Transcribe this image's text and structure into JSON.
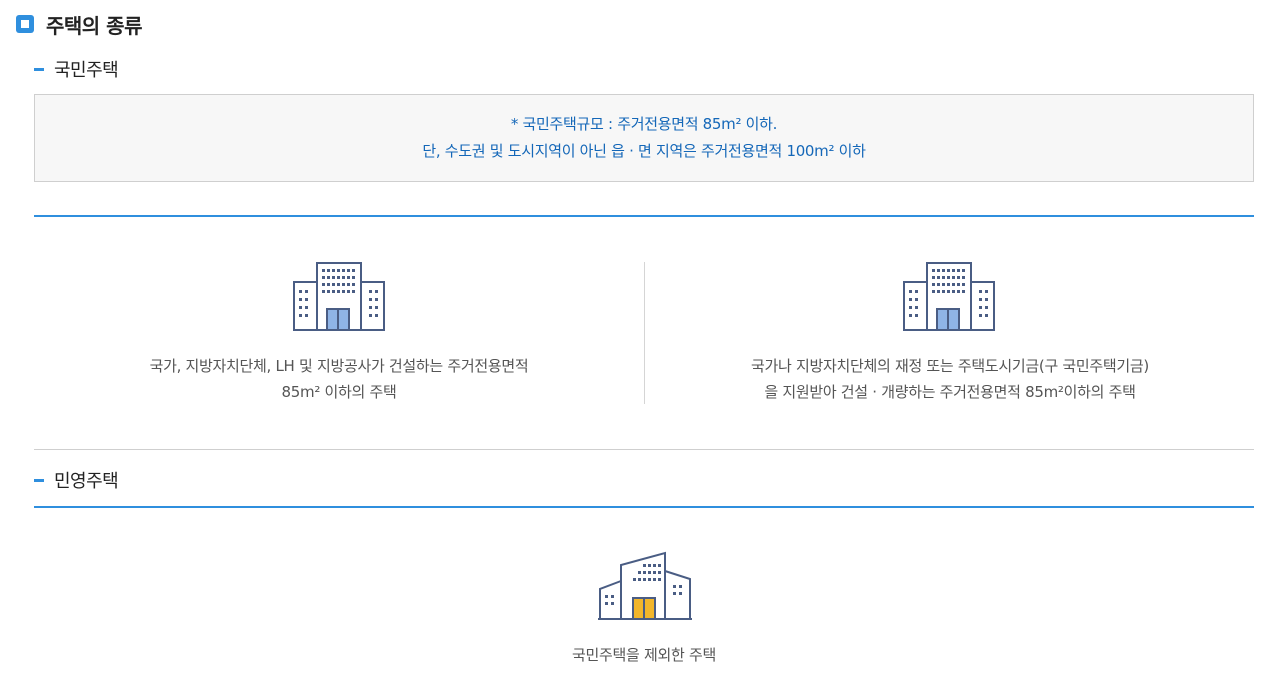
{
  "page": {
    "title": "주택의 종류"
  },
  "national": {
    "heading": "국민주택",
    "note_line1": "* 국민주택규모 : 주거전용면적 85m² 이하.",
    "note_line2": "단, 수도권 및 도시지역이 아닌 읍 · 면 지역은 주거전용면적 100m² 이하",
    "items": [
      {
        "icon": "apartment-building-icon",
        "line1": "국가, 지방자치단체, LH 및 지방공사가 건설하는 주거전용면적",
        "line2": "85m² 이하의 주택"
      },
      {
        "icon": "apartment-building-icon",
        "line1": "국가나 지방자치단체의 재정 또는 주택도시기금(구 국민주택기금)",
        "line2": "을 지원받아 건설 · 개량하는 주거전용면적 85m²이하의 주택"
      }
    ]
  },
  "private": {
    "heading": "민영주택",
    "item": {
      "icon": "private-building-icon",
      "text": "국민주택을 제외한 주택"
    }
  },
  "colors": {
    "accent": "#2f8fde",
    "note_text": "#1467b8",
    "building_stroke": "#4a5d84",
    "door_blue": "#8fb4e6",
    "door_yellow": "#f2b62b"
  }
}
